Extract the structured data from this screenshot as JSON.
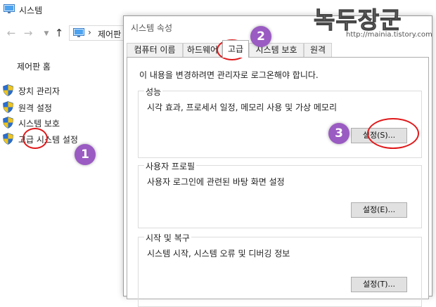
{
  "explorer": {
    "title": "시스템",
    "address": {
      "separator": "›",
      "text": "제어판"
    },
    "sidebar": {
      "home": "제어판 홈",
      "items": [
        {
          "label": "장치 관리자"
        },
        {
          "label": "원격 설정"
        },
        {
          "label": "시스템 보호"
        },
        {
          "label": "고급 시스템 설정"
        }
      ]
    }
  },
  "dialog": {
    "title": "시스템 속성",
    "tabs": {
      "computer_name": "컴퓨터 이름",
      "hardware": "하드웨어",
      "advanced": "고급",
      "protection": "시스템 보호",
      "remote": "원격"
    },
    "active_tab": "고급",
    "admin_note": "이 내용을 변경하려면 관리자로 로그온해야 합니다.",
    "performance": {
      "title": "성능",
      "desc": "시각 효과, 프로세서 일정, 메모리 사용 및 가상 메모리",
      "button": "설정(S)..."
    },
    "profile": {
      "title": "사용자 프로필",
      "desc": "사용자 로그인에 관련된 바탕 화면 설정",
      "button": "설정(E)..."
    },
    "startup": {
      "title": "시작 및 복구",
      "desc": "시스템 시작, 시스템 오류 및 디버깅 정보",
      "button": "설정(T)..."
    }
  },
  "annotations": {
    "badge1": "1",
    "badge2": "2",
    "badge3": "3"
  },
  "watermark": {
    "title": "녹두장군",
    "url": "http://mainia.tistory.com"
  },
  "colors": {
    "annotation_ring": "#e0191b",
    "badge": "#9a5bc2",
    "shield_blue": "#2a6fd1",
    "shield_yellow": "#f0c419"
  }
}
